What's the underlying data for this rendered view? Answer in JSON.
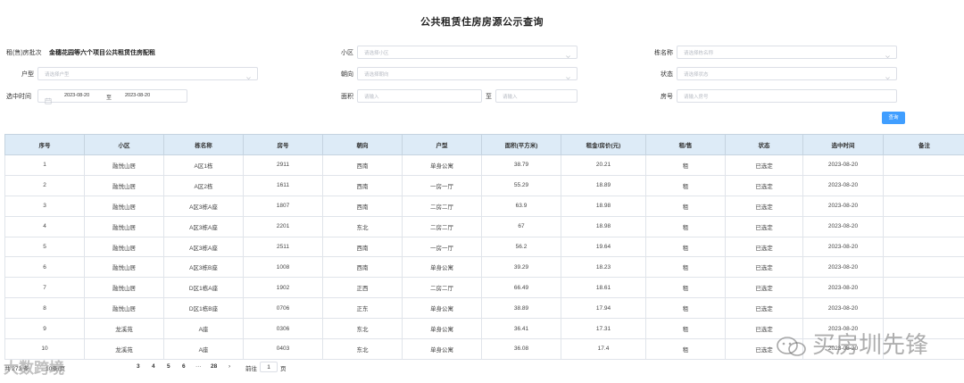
{
  "title": "公共租赁住房房源公示查询",
  "form": {
    "batch_label": "租(售)房批次",
    "batch_value": "金穗花园等六个项目公共租赁住房配租",
    "community_label": "小区",
    "community_placeholder": "请选择小区",
    "building_label": "栋名称",
    "building_placeholder": "请选择栋名称",
    "type_label": "户型",
    "type_placeholder": "请选择户型",
    "orientation_label": "朝向",
    "orientation_placeholder": "请选择朝向",
    "status_label": "状态",
    "status_placeholder": "请选择状态",
    "time_label": "选中时间",
    "date_start": "2023-08-20",
    "date_sep": "至",
    "date_end": "2023-08-20",
    "area_label": "面积",
    "area_min_placeholder": "请输入",
    "area_sep": "至",
    "area_max_placeholder": "请输入",
    "room_label": "房号",
    "room_placeholder": "请输入房号",
    "search_button": "查询"
  },
  "table": {
    "headers": [
      "序号",
      "小区",
      "栋名称",
      "房号",
      "朝向",
      "户型",
      "面积(平方米)",
      "租金/房价(元)",
      "租/售",
      "状态",
      "选中时间",
      "备注"
    ],
    "rows": [
      [
        "1",
        "融悦山居",
        "A区1栋",
        "2911",
        "西南",
        "单身公寓",
        "38.79",
        "20.21",
        "租",
        "已选定",
        "2023-08-20",
        ""
      ],
      [
        "2",
        "融悦山居",
        "A区2栋",
        "1611",
        "西南",
        "一房一厅",
        "55.29",
        "18.89",
        "租",
        "已选定",
        "2023-08-20",
        ""
      ],
      [
        "3",
        "融悦山居",
        "A区3栋A座",
        "1807",
        "西南",
        "二房二厅",
        "63.9",
        "18.98",
        "租",
        "已选定",
        "2023-08-20",
        ""
      ],
      [
        "4",
        "融悦山居",
        "A区3栋A座",
        "2201",
        "东北",
        "二房二厅",
        "67",
        "18.98",
        "租",
        "已选定",
        "2023-08-20",
        ""
      ],
      [
        "5",
        "融悦山居",
        "A区3栋A座",
        "2511",
        "西南",
        "一房一厅",
        "56.2",
        "19.64",
        "租",
        "已选定",
        "2023-08-20",
        ""
      ],
      [
        "6",
        "融悦山居",
        "A区3栋B座",
        "1008",
        "西南",
        "单身公寓",
        "39.29",
        "18.23",
        "租",
        "已选定",
        "2023-08-20",
        ""
      ],
      [
        "7",
        "融悦山居",
        "D区1栋A座",
        "1902",
        "正西",
        "二房二厅",
        "66.49",
        "18.61",
        "租",
        "已选定",
        "2023-08-20",
        ""
      ],
      [
        "8",
        "融悦山居",
        "D区1栋B座",
        "0706",
        "正东",
        "单身公寓",
        "38.89",
        "17.94",
        "租",
        "已选定",
        "2023-08-20",
        ""
      ],
      [
        "9",
        "龙溪苑",
        "A座",
        "0306",
        "东北",
        "单身公寓",
        "36.41",
        "17.31",
        "租",
        "已选定",
        "2023-08-20",
        ""
      ],
      [
        "10",
        "龙溪苑",
        "A座",
        "0403",
        "东北",
        "单身公寓",
        "36.08",
        "17.4",
        "租",
        "已选定",
        "2023-08-20",
        ""
      ]
    ]
  },
  "pagination": {
    "total": "共 273 条",
    "page_size": "10条/页",
    "pages": [
      "3",
      "4",
      "5",
      "6"
    ],
    "ellipsis": "···",
    "last_page": "28",
    "next": "›",
    "goto_label": "前往",
    "current": "1",
    "page_unit": "页"
  },
  "watermarks": {
    "left": "大数跨境",
    "right": "买房圳先锋"
  }
}
